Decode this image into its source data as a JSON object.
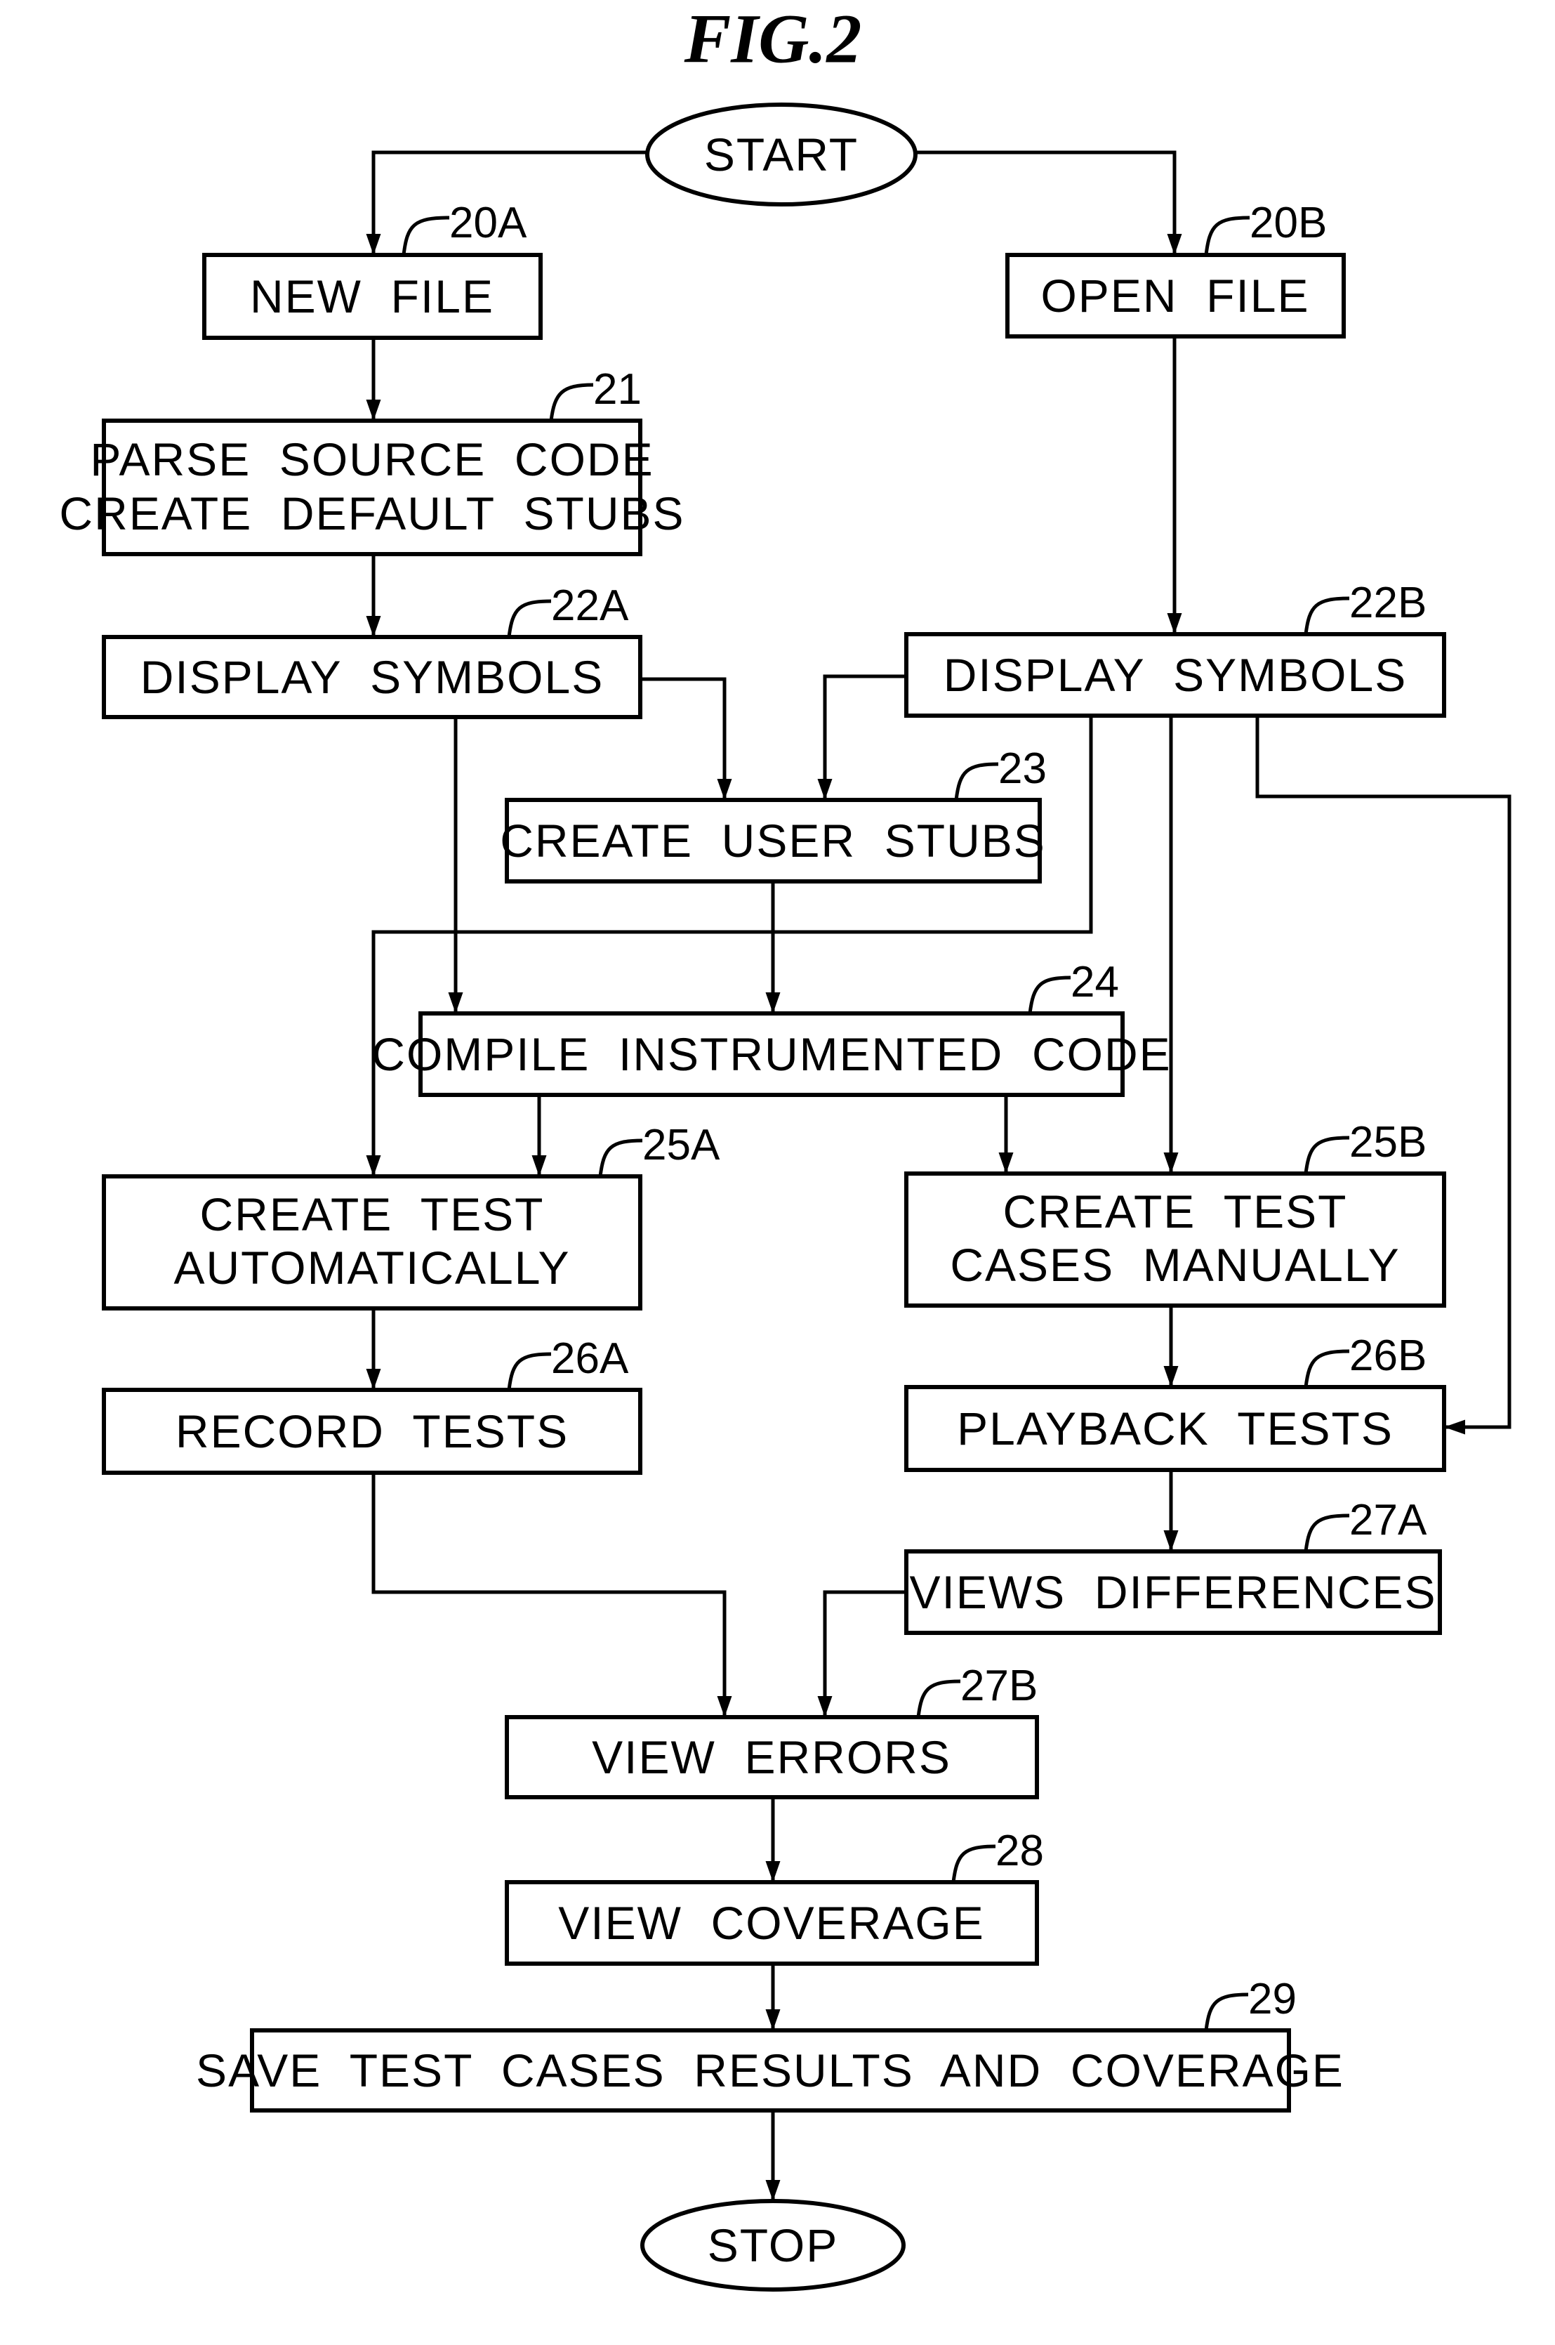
{
  "figure": {
    "title": "FIG.2"
  },
  "terminals": {
    "start": "START",
    "stop": "STOP"
  },
  "steps": [
    {
      "id": "20A",
      "ref": "20A",
      "lines": [
        "NEW  FILE"
      ]
    },
    {
      "id": "20B",
      "ref": "20B",
      "lines": [
        "OPEN  FILE"
      ]
    },
    {
      "id": "21",
      "ref": "21",
      "lines": [
        "PARSE  SOURCE  CODE",
        "CREATE  DEFAULT  STUBS"
      ]
    },
    {
      "id": "22A",
      "ref": "22A",
      "lines": [
        "DISPLAY  SYMBOLS"
      ]
    },
    {
      "id": "22B",
      "ref": "22B",
      "lines": [
        "DISPLAY  SYMBOLS"
      ]
    },
    {
      "id": "23",
      "ref": "23",
      "lines": [
        "CREATE  USER  STUBS"
      ]
    },
    {
      "id": "24",
      "ref": "24",
      "lines": [
        "COMPILE  INSTRUMENTED  CODE"
      ]
    },
    {
      "id": "25A",
      "ref": "25A",
      "lines": [
        "CREATE  TEST",
        "AUTOMATICALLY"
      ]
    },
    {
      "id": "25B",
      "ref": "25B",
      "lines": [
        "CREATE  TEST",
        "CASES  MANUALLY"
      ]
    },
    {
      "id": "26A",
      "ref": "26A",
      "lines": [
        "RECORD  TESTS"
      ]
    },
    {
      "id": "26B",
      "ref": "26B",
      "lines": [
        "PLAYBACK  TESTS"
      ]
    },
    {
      "id": "27A",
      "ref": "27A",
      "lines": [
        "VIEWS  DIFFERENCES"
      ]
    },
    {
      "id": "27B",
      "ref": "27B",
      "lines": [
        "VIEW  ERRORS"
      ]
    },
    {
      "id": "28",
      "ref": "28",
      "lines": [
        "VIEW  COVERAGE"
      ]
    },
    {
      "id": "29",
      "ref": "29",
      "lines": [
        "SAVE  TEST  CASES  RESULTS  AND  COVERAGE"
      ]
    }
  ],
  "connections": [
    {
      "from": "START",
      "to": "20A"
    },
    {
      "from": "START",
      "to": "20B"
    },
    {
      "from": "20A",
      "to": "21"
    },
    {
      "from": "21",
      "to": "22A"
    },
    {
      "from": "20B",
      "to": "22B"
    },
    {
      "from": "22A",
      "to": "23"
    },
    {
      "from": "22B",
      "to": "23"
    },
    {
      "from": "22A",
      "to": "24"
    },
    {
      "from": "23",
      "to": "24"
    },
    {
      "from": "22B",
      "to": "25A"
    },
    {
      "from": "24",
      "to": "25A"
    },
    {
      "from": "24",
      "to": "25B"
    },
    {
      "from": "22B",
      "to": "25B"
    },
    {
      "from": "22B",
      "to": "26B"
    },
    {
      "from": "25A",
      "to": "26A"
    },
    {
      "from": "25B",
      "to": "26B"
    },
    {
      "from": "26B",
      "to": "27A"
    },
    {
      "from": "26A",
      "to": "27B"
    },
    {
      "from": "27A",
      "to": "27B"
    },
    {
      "from": "27B",
      "to": "28"
    },
    {
      "from": "28",
      "to": "29"
    },
    {
      "from": "29",
      "to": "STOP"
    }
  ]
}
